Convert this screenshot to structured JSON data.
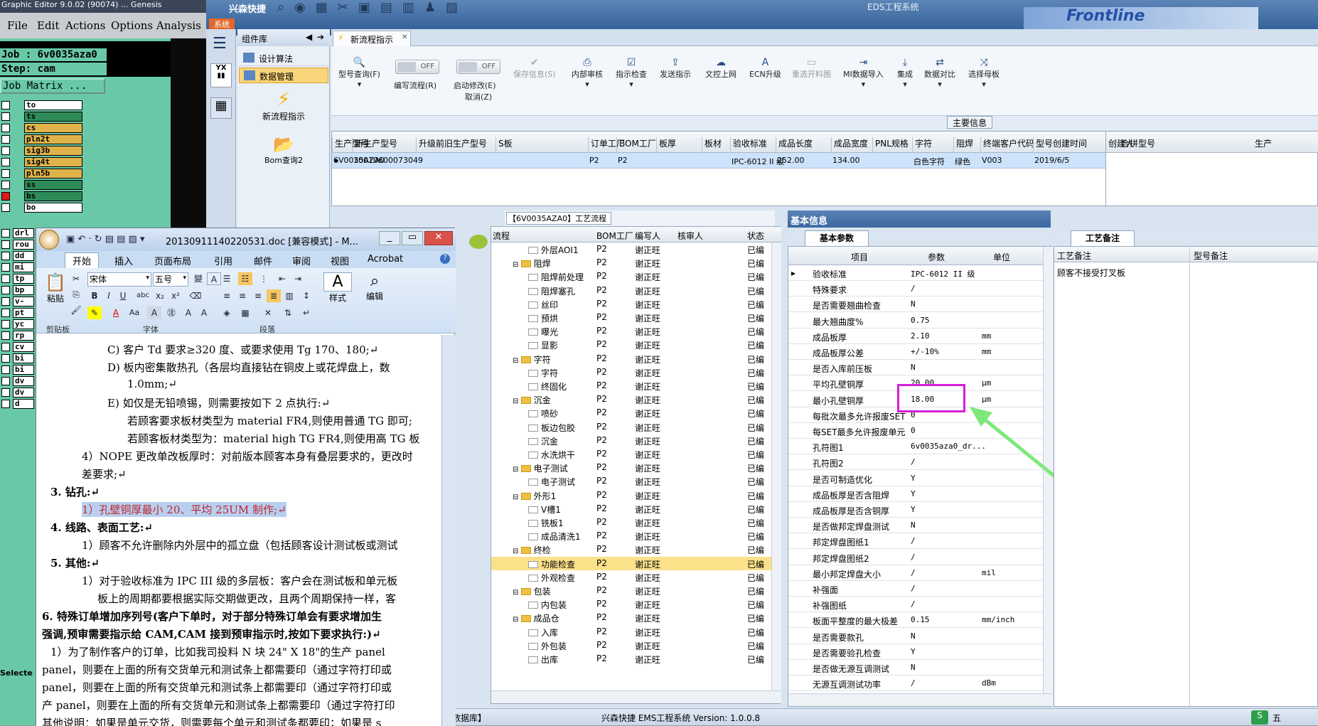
{
  "genesis": {
    "title": "Graphic Editor 9.0.02 (90074) ... Genesis",
    "menu": [
      "File",
      "Edit",
      "Actions",
      "Options",
      "Analysis"
    ],
    "job_line": "Job : 6v0035aza0",
    "step_line": "Step: cam",
    "job_matrix_button": "Job Matrix ...",
    "layers": [
      "to",
      "ts",
      "cs",
      "pln2t",
      "sig3b",
      "sig4t",
      "pln5b",
      "ss",
      "bs",
      "bo"
    ],
    "lower_layers": [
      "drl",
      "rou",
      "dd",
      "mi",
      "tp",
      "bp",
      "v-",
      "pt",
      "yc",
      "rp",
      "cv",
      "bi",
      "bi",
      "dv",
      "dv",
      "d"
    ],
    "select_label": "Selecte"
  },
  "eds": {
    "app_name": "兴森快捷",
    "system_tab": "系统",
    "window_title": "EDS工程系统",
    "side_menu": {
      "header": "组件库",
      "items": [
        "设计算法",
        "数据管理"
      ],
      "tiles": [
        "新流程指示",
        "Bom查询2"
      ]
    },
    "doc_tab": "新流程指示",
    "toolbar": {
      "buttons": [
        "型号查询(F)",
        "编写流程(R)",
        "启动修改(E)",
        "保存信息(S)",
        "内部审核",
        "指示检查",
        "发送指示",
        "文控上网",
        "ECN升级",
        "重选开料图",
        "MI数据导入",
        "集成",
        "数据对比",
        "选择母板"
      ],
      "toggle1": "OFF",
      "toggle2": "OFF",
      "cancel_label": "取消(Z)"
    },
    "main_info_caption": "主要信息",
    "main_grid": {
      "headers": [
        "生产型号",
        "新生产型号",
        "升级前旧生产型号",
        "S板",
        "订单工厂",
        "BOM工厂",
        "板厚",
        "板材",
        "验收标准",
        "成品长度",
        "成品宽度",
        "PNL规格",
        "字符",
        "阻焊",
        "终端客户代码",
        "型号创建时间",
        "创建人"
      ],
      "row": [
        "6V0035AZA0",
        "10010600073049",
        "",
        "",
        "P2",
        "P2",
        "",
        "",
        "IPC-6012 II 级",
        "252.00",
        "134.00",
        "",
        "白色字符",
        "绿色",
        "V003",
        "2019/6/5",
        ""
      ],
      "right_headers": [
        "合拼型号",
        "生产"
      ]
    },
    "process_caption": "【6V0035AZA0】工艺流程",
    "process_headers": [
      "流程",
      "BOM工厂",
      "编写人",
      "核审人",
      "状态"
    ],
    "process_rows": [
      {
        "name": "外层AOI1",
        "level": 2,
        "bom": "P2",
        "writer": "谢正旺",
        "status": "已编"
      },
      {
        "name": "阻焊",
        "level": 1,
        "bom": "P2",
        "writer": "谢正旺",
        "status": "已编"
      },
      {
        "name": "阻焊前处理",
        "level": 2,
        "bom": "P2",
        "writer": "谢正旺",
        "status": "已编"
      },
      {
        "name": "阻焊塞孔",
        "level": 2,
        "bom": "P2",
        "writer": "谢正旺",
        "status": "已编"
      },
      {
        "name": "丝印",
        "level": 2,
        "bom": "P2",
        "writer": "谢正旺",
        "status": "已编"
      },
      {
        "name": "预烘",
        "level": 2,
        "bom": "P2",
        "writer": "谢正旺",
        "status": "已编"
      },
      {
        "name": "曝光",
        "level": 2,
        "bom": "P2",
        "writer": "谢正旺",
        "status": "已编"
      },
      {
        "name": "显影",
        "level": 2,
        "bom": "P2",
        "writer": "谢正旺",
        "status": "已编"
      },
      {
        "name": "字符",
        "level": 1,
        "bom": "P2",
        "writer": "谢正旺",
        "status": "已编"
      },
      {
        "name": "字符",
        "level": 2,
        "bom": "P2",
        "writer": "谢正旺",
        "status": "已编"
      },
      {
        "name": "终固化",
        "level": 2,
        "bom": "P2",
        "writer": "谢正旺",
        "status": "已编"
      },
      {
        "name": "沉金",
        "level": 1,
        "bom": "P2",
        "writer": "谢正旺",
        "status": "已编"
      },
      {
        "name": "喷砂",
        "level": 2,
        "bom": "P2",
        "writer": "谢正旺",
        "status": "已编"
      },
      {
        "name": "板边包胶",
        "level": 2,
        "bom": "P2",
        "writer": "谢正旺",
        "status": "已编"
      },
      {
        "name": "沉金",
        "level": 2,
        "bom": "P2",
        "writer": "谢正旺",
        "status": "已编"
      },
      {
        "name": "水洗烘干",
        "level": 2,
        "bom": "P2",
        "writer": "谢正旺",
        "status": "已编"
      },
      {
        "name": "电子测试",
        "level": 1,
        "bom": "P2",
        "writer": "谢正旺",
        "status": "已编"
      },
      {
        "name": "电子测试",
        "level": 2,
        "bom": "P2",
        "writer": "谢正旺",
        "status": "已编"
      },
      {
        "name": "外形1",
        "level": 1,
        "bom": "P2",
        "writer": "谢正旺",
        "status": "已编"
      },
      {
        "name": "V槽1",
        "level": 2,
        "bom": "P2",
        "writer": "谢正旺",
        "status": "已编"
      },
      {
        "name": "铣板1",
        "level": 2,
        "bom": "P2",
        "writer": "谢正旺",
        "status": "已编"
      },
      {
        "name": "成品清洗1",
        "level": 2,
        "bom": "P2",
        "writer": "谢正旺",
        "status": "已编"
      },
      {
        "name": "终检",
        "level": 1,
        "bom": "P2",
        "writer": "谢正旺",
        "status": "已编"
      },
      {
        "name": "功能检查",
        "level": 2,
        "bom": "P2",
        "writer": "谢正旺",
        "status": "已编",
        "selected": true
      },
      {
        "name": "外观检查",
        "level": 2,
        "bom": "P2",
        "writer": "谢正旺",
        "status": "已编"
      },
      {
        "name": "包装",
        "level": 1,
        "bom": "P2",
        "writer": "谢正旺",
        "status": "已编"
      },
      {
        "name": "内包装",
        "level": 2,
        "bom": "P2",
        "writer": "谢正旺",
        "status": "已编"
      },
      {
        "name": "成品仓",
        "level": 1,
        "bom": "P2",
        "writer": "谢正旺",
        "status": "已编"
      },
      {
        "name": "入库",
        "level": 2,
        "bom": "P2",
        "writer": "谢正旺",
        "status": "已编"
      },
      {
        "name": "外包装",
        "level": 2,
        "bom": "P2",
        "writer": "谢正旺",
        "status": "已编"
      },
      {
        "name": "出库",
        "level": 2,
        "bom": "P2",
        "writer": "谢正旺",
        "status": "已编"
      }
    ],
    "basic_info_tab": "基本信息",
    "basic_params_tab": "基本参数",
    "param_headers": [
      "项目",
      "参数",
      "单位"
    ],
    "params": [
      [
        "验收标准",
        "IPC-6012 II 级",
        ""
      ],
      [
        "特殊要求",
        "/",
        ""
      ],
      [
        "是否需要翘曲检查",
        "N",
        ""
      ],
      [
        "最大翘曲度%",
        "0.75",
        ""
      ],
      [
        "成品板厚",
        "2.10",
        "mm"
      ],
      [
        "成品板厚公差",
        "+/-10%",
        "mm"
      ],
      [
        "是否入库前压板",
        "N",
        ""
      ],
      [
        "平均孔壁铜厚",
        "20.00",
        "μm"
      ],
      [
        "最小孔壁铜厚",
        "18.00",
        "μm"
      ],
      [
        "每批次最多允许报废SET",
        "0",
        ""
      ],
      [
        "每SET最多允许报废单元",
        "0",
        ""
      ],
      [
        "孔符图1",
        "6v0035aza0_dr...",
        ""
      ],
      [
        "孔符图2",
        "/",
        ""
      ],
      [
        "是否可制造优化",
        "Y",
        ""
      ],
      [
        "成品板厚是否含阻焊",
        "Y",
        ""
      ],
      [
        "成品板厚是否含铜厚",
        "Y",
        ""
      ],
      [
        "是否做邦定焊盘测试",
        "N",
        ""
      ],
      [
        "邦定焊盘图纸1",
        "/",
        ""
      ],
      [
        "邦定焊盘图纸2",
        "/",
        ""
      ],
      [
        "最小邦定焊盘大小",
        "/",
        "mil"
      ],
      [
        "补强面",
        "/",
        ""
      ],
      [
        "补强图纸",
        "/",
        ""
      ],
      [
        "板面平整度的最大极差",
        "0.15",
        "mm/inch"
      ],
      [
        "是否需要款孔",
        "N",
        ""
      ],
      [
        "是否需要验孔检查",
        "Y",
        ""
      ],
      [
        "是否做无源互调测试",
        "N",
        ""
      ],
      [
        "无源互调测试功率",
        "/",
        "dBm"
      ]
    ],
    "process_remark_tab": "工艺备注",
    "remark_headers": [
      "工艺备注",
      "型号备注"
    ],
    "remark_text": "顾客不接受打叉板",
    "status_bar": {
      "left": "数据库】",
      "center": "兴森快捷 EMS工程系统 Version: 1.0.0.8",
      "ime": "五"
    },
    "highlight_color": "#d61fd6",
    "arrow_color": "#7ee87a"
  },
  "word": {
    "title": "20130911140220531.doc [兼容模式] - M...",
    "tabs": [
      "开始",
      "插入",
      "页面布局",
      "引用",
      "邮件",
      "审阅",
      "视图",
      "Acrobat"
    ],
    "font_name": "宋体",
    "font_size": "五号",
    "groups": [
      "剪贴板",
      "字体",
      "段落",
      "样式",
      "编辑"
    ],
    "paste_label": "粘贴",
    "style_label": "样式",
    "edit_label": "编辑",
    "lines": [
      "C)  客户 Td 要求≥320 度、或要求使用 Tg 170、180;↵",
      "D)  板内密集散热孔（各层均直接钻在铜皮上或花焊盘上，数",
      "1.0mm;↵",
      "E)  如仅是无铅喷锡，则需要按如下 2 点执行:↵",
      "若顾客要求板材类型为 material FR4,则使用普通 TG 即可;",
      "若顾客板材类型为：material high TG FR4,则使用高 TG 板",
      "4）NOPE 更改单改板厚时：对前版本顾客本身有叠层要求的，更改时",
      "差要求;↵",
      "3.   钻孔:↵",
      "1）孔壁铜厚最小 20、平均 25UM 制作;↵",
      "4.   线路、表面工艺:↵",
      "1）顾客不允许删除内外层中的孤立盘（包括顾客设计测试板或测试",
      "5.   其他:↵",
      "1）对于验收标准为 IPC III 级的多层板：客户会在测试板和单元板",
      "板上的周期都要根据实际交期做更改，且两个周期保持一样，客",
      "6. 特殊订单增加序列号(客户下单时，对于部分特殊订单会有要求增加生",
      "强调,预审需要指示给 CAM,CAM 接到预审指示时,按如下要求执行:)↵",
      "1）为了制作客户的订单，比如我司投料 N 块 24\" X 18\"的生产 panel",
      "panel，则要在上面的所有交货单元和测试条上都需要印（通过字符打印或",
      "panel，则要在上面的所有交货单元和测试条上都需要印（通过字符打印或",
      "产 panel，则要在上面的所有交货单元和测试条上都需要印（通过字符打印",
      "其他说明：如果是单元交货，则需要每个单元和测试条都要印；如果是 s"
    ]
  }
}
